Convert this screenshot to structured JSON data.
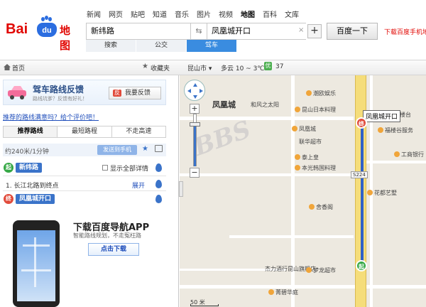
{
  "header": {
    "logo": {
      "bai": "Bai",
      "du": "du",
      "map": "地图"
    },
    "nav": [
      "新闻",
      "网页",
      "贴吧",
      "知道",
      "音乐",
      "图片",
      "视频",
      "地图",
      "百科",
      "文库"
    ],
    "nav_active": "地图",
    "from_value": "新纬路",
    "to_value": "凤凰城开口",
    "search_label": "百度一下",
    "download_link": "下载百度手机地图",
    "modes": [
      "搜索",
      "公交",
      "驾车"
    ],
    "mode_active": "驾车"
  },
  "toolbar": {
    "home": "首页",
    "favorites": "收藏夹",
    "city": "昆山市 ▾",
    "weather": "多云 10 ~ 3℃",
    "aqi_badge": "优",
    "aqi_value": "37"
  },
  "feedback": {
    "title": "驾车路线反馈",
    "subtitle": "路线坑爹？反馈有好礼！",
    "button": "我要反馈",
    "button_icon": "反"
  },
  "rate_link": "推荐的路线满意吗？给个评价吧！",
  "route_tabs": [
    "推荐路线",
    "最短路程",
    "不走高速"
  ],
  "route_tab_active": "推荐路线",
  "summary": {
    "text": "约240米/1分钟",
    "send": "发送到手机"
  },
  "steps": {
    "start_marker": "起",
    "start_name": "新纬路",
    "show_all": "显示全部详情",
    "step1": "1. 长江北路到终点",
    "expand": "展开",
    "end_marker": "终",
    "end_name": "凤凰城开口"
  },
  "promo": {
    "title": "下载百度导航APP",
    "subtitle": "智能路线规划，不走冤枉路",
    "button": "点击下载"
  },
  "map": {
    "area_label": "凤凰城",
    "end_callout": "凤凰城开口",
    "road_tag": "S224",
    "scale": "50 米",
    "start_pin": "起",
    "end_pin": "终",
    "zoom_in": "+",
    "zoom_out": "−",
    "watermark": "BBS",
    "pois": [
      {
        "name": "潮欧娱乐"
      },
      {
        "name": "和风之太阳"
      },
      {
        "name": "昆山日本料理"
      },
      {
        "name": "凤凰城"
      },
      {
        "name": "福楼台"
      },
      {
        "name": "福楼谷服务"
      },
      {
        "name": "联华超市"
      },
      {
        "name": "泰上皇"
      },
      {
        "name": "本光韩国料理"
      },
      {
        "name": "工商银行"
      },
      {
        "name": "花都艺墅"
      },
      {
        "name": "舍香阁"
      },
      {
        "name": "杰力酒行昆山旗舰店"
      },
      {
        "name": "梦龙超市"
      },
      {
        "name": "菁碧华庭"
      }
    ]
  }
}
